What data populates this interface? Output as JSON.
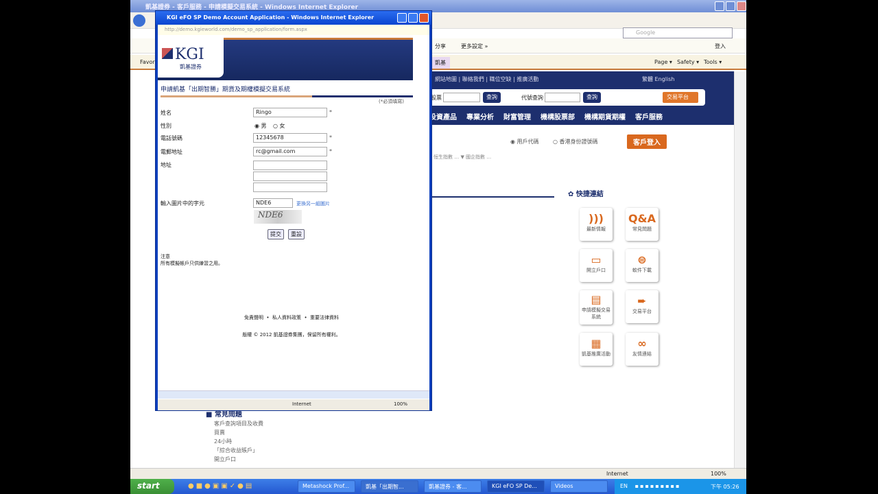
{
  "background_window": {
    "title": "凱基證券 - 客戶服務 - 申請模擬交易系統 - Windows Internet Explorer",
    "search_placeholder": "Google",
    "toolbar": {
      "share": "分享",
      "more": "更多設定 »",
      "signin": "登入"
    },
    "command_bar": {
      "favorites": "Favorites",
      "tab": "凱基",
      "page": "Page ▾",
      "safety": "Safety ▾",
      "tools": "Tools ▾"
    },
    "header_links": "網站地圖 | 聯絡我們 | 職位空缺 | 推廣活動",
    "language": "繁體  English",
    "search1_label": "股票",
    "search2_label": "代號查詢",
    "search_button": "查詢",
    "trade_platform": "交易平台",
    "nav": [
      "投資產品",
      "專業分析",
      "財富管理",
      "機構股票部",
      "機構期貨期權",
      "客戶服務"
    ],
    "login": {
      "radio1": "用戶代碼",
      "radio2": "香港身份證號碼",
      "button": "客戶登入"
    },
    "ticker": "恒生指數 … ▼ 國企指數 … ",
    "quick_links_title": "快捷連結",
    "quick_links": [
      {
        "label": "最新情報",
        "icon": "rss-icon"
      },
      {
        "label": "常見問題",
        "icon": "qa-icon"
      },
      {
        "label": "開立戶口",
        "icon": "card-icon"
      },
      {
        "label": "軟件下載",
        "icon": "download-icon"
      },
      {
        "label": "申請模擬交易系統",
        "icon": "demo-icon"
      },
      {
        "label": "交易平台",
        "icon": "arrow-icon"
      },
      {
        "label": "凱基推廣活動",
        "icon": "calendar-icon"
      },
      {
        "label": "友情連結",
        "icon": "link-icon"
      }
    ],
    "faq": {
      "title": "常見問題",
      "items": [
        "客戶查詢項目及收費",
        "買賣",
        "24小時",
        "「綜合收益賬戶」",
        "開立戶口"
      ]
    },
    "status": {
      "zone": "Internet",
      "zoom": "100%"
    }
  },
  "popup": {
    "title": "KGI eFO SP Demo Account Application - Windows Internet Explorer",
    "url": "http://demo.kgieworld.com/demo_sp_application/form.aspx",
    "logo_text": "KGI",
    "logo_sub": "凱基證券",
    "form_title": "申請凱基「出期智勝」期貨及期權模擬交易系統",
    "required_note": "(*必須填寫)",
    "fields": [
      {
        "label": "姓名",
        "value": "Ringo",
        "required": "*"
      },
      {
        "label": "性別",
        "male": "男",
        "female": "女"
      },
      {
        "label": "電話號碼",
        "value": "12345678",
        "required": "*"
      },
      {
        "label": "電郵地址",
        "value": "rc@gmail.com",
        "required": "*"
      },
      {
        "label": "地址",
        "value": ""
      }
    ],
    "captcha_label": "輸入圖片中的字元",
    "captcha_value": "NDE6",
    "captcha_image": "NDE6",
    "captcha_refresh": "更換另一組圖片",
    "submit": "提交",
    "reset": "重設",
    "note_title": "注意",
    "note_text": "所有模擬帳戶只供練習之用。",
    "footer_links": [
      "免責聲明",
      "私人資料政策",
      "重要法律資料"
    ],
    "copyright": "版權 © 2012 凱基證券集團，保留所有權利。",
    "status": {
      "zone": "Internet",
      "zoom": "100%"
    }
  },
  "taskbar": {
    "start": "start",
    "tasks": [
      "Metashock Prof...",
      "凱基「出期智...",
      "凱基證券 - 客...",
      "KGI eFO SP De...",
      "Videos"
    ],
    "lang": "EN",
    "clock": "下午 05:26"
  }
}
